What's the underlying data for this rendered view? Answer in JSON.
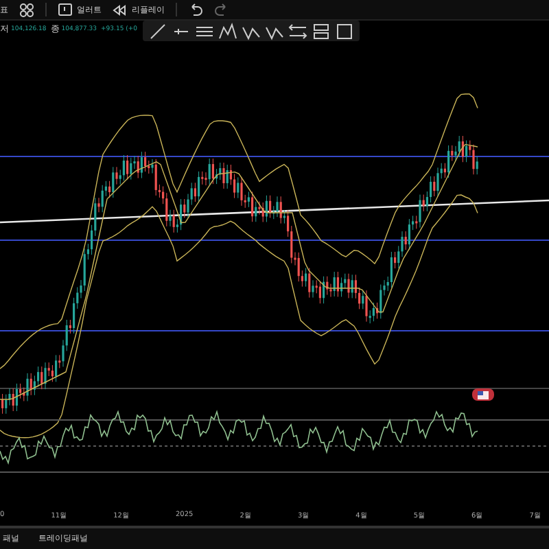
{
  "toolbar": [
    {
      "kind": "text",
      "label": "표"
    },
    {
      "kind": "grid"
    },
    {
      "kind": "alert",
      "label": "얼러트"
    },
    {
      "kind": "replay",
      "label": "리플레이"
    },
    {
      "kind": "undo"
    },
    {
      "kind": "redo"
    }
  ],
  "legend": [
    {
      "label": "저",
      "value": "104,126.18"
    },
    {
      "label": "종",
      "value": "104,877.33"
    },
    {
      "value": "+93.15 (+0"
    }
  ],
  "drawing_tools": [
    {
      "kind": "line"
    },
    {
      "kind": "ray"
    },
    {
      "kind": "channel"
    },
    {
      "kind": "pattern"
    },
    {
      "kind": "zigzag"
    },
    {
      "kind": "zigzag"
    },
    {
      "kind": "arrows"
    },
    {
      "kind": "rects"
    },
    {
      "kind": "square"
    }
  ],
  "time_axis": [
    "0",
    "11월",
    "12월",
    "2025",
    "2월",
    "3월",
    "4월",
    "5월",
    "6월",
    "7월"
  ],
  "bottom_tabs": [
    "패널",
    "트레이딩패널"
  ]
}
